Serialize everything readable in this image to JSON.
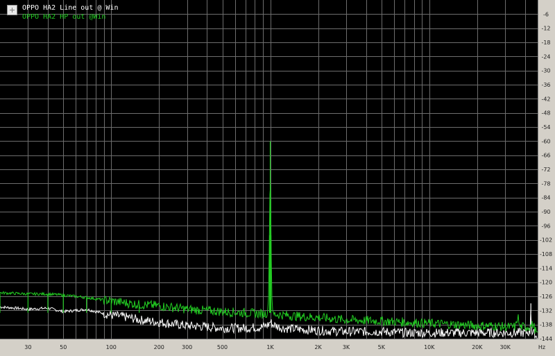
{
  "colors": {
    "plot_background": "#000000",
    "grid": "#6e6e6e",
    "window": "#d4d0c8",
    "series_white": "#ffffff",
    "series_green": "#22cc22"
  },
  "legend": {
    "icon": "legend-toggle-icon",
    "entries": [
      {
        "label": "OPPO HA2 Line out @ Win",
        "color": "#ffffff"
      },
      {
        "label": "OPPO HA2 HP out @Win",
        "color": "#22cc22"
      }
    ]
  },
  "chart_data": {
    "type": "line",
    "title": "",
    "xlabel": "",
    "ylabel": "",
    "x_scale": "log",
    "xlim": [
      20,
      48000
    ],
    "ylim": [
      0,
      -144
    ],
    "grid": true,
    "legend_position": "top-left",
    "x_ticks": [
      {
        "value": 30,
        "label": "30"
      },
      {
        "value": 50,
        "label": "50"
      },
      {
        "value": 100,
        "label": "100"
      },
      {
        "value": 200,
        "label": "200"
      },
      {
        "value": 300,
        "label": "300"
      },
      {
        "value": 500,
        "label": "500"
      },
      {
        "value": 1000,
        "label": "1K"
      },
      {
        "value": 2000,
        "label": "2K"
      },
      {
        "value": 3000,
        "label": "3K"
      },
      {
        "value": 5000,
        "label": "5K"
      },
      {
        "value": 10000,
        "label": "10K"
      },
      {
        "value": 20000,
        "label": "20K"
      },
      {
        "value": 30000,
        "label": "30K"
      }
    ],
    "x_unit_label": "Hz",
    "y_ticks": [
      {
        "value": -6,
        "label": "-6"
      },
      {
        "value": -12,
        "label": "-12"
      },
      {
        "value": -18,
        "label": "-18"
      },
      {
        "value": -24,
        "label": "-24"
      },
      {
        "value": -30,
        "label": "-30"
      },
      {
        "value": -36,
        "label": "-36"
      },
      {
        "value": -42,
        "label": "-42"
      },
      {
        "value": -48,
        "label": "-48"
      },
      {
        "value": -54,
        "label": "-54"
      },
      {
        "value": -60,
        "label": "-60"
      },
      {
        "value": -66,
        "label": "-66"
      },
      {
        "value": -72,
        "label": "-72"
      },
      {
        "value": -78,
        "label": "-78"
      },
      {
        "value": -84,
        "label": "-84"
      },
      {
        "value": -90,
        "label": "-90"
      },
      {
        "value": -96,
        "label": "-96"
      },
      {
        "value": -102,
        "label": "-102"
      },
      {
        "value": -108,
        "label": "-108"
      },
      {
        "value": -114,
        "label": "-114"
      },
      {
        "value": -120,
        "label": "-120"
      },
      {
        "value": -126,
        "label": "-126"
      },
      {
        "value": -132,
        "label": "-132"
      },
      {
        "value": -138,
        "label": "-138"
      },
      {
        "value": -144,
        "label": "-144"
      }
    ],
    "series": [
      {
        "name": "OPPO HA2 Line out @ Win",
        "color": "#ffffff",
        "points": [
          [
            20,
            -130.5
          ],
          [
            25,
            -131.0
          ],
          [
            30,
            -131.5
          ],
          [
            40,
            -131.0
          ],
          [
            50,
            -132.5
          ],
          [
            60,
            -132.0
          ],
          [
            70,
            -131.5
          ],
          [
            80,
            -132.5
          ],
          [
            100,
            -134.0
          ],
          [
            130,
            -135.0
          ],
          [
            150,
            -136.0
          ],
          [
            200,
            -137.0
          ],
          [
            300,
            -138.5
          ],
          [
            400,
            -139.0
          ],
          [
            500,
            -139.5
          ],
          [
            700,
            -139.5
          ],
          [
            900,
            -139.0
          ],
          [
            980,
            -138.0
          ],
          [
            1000,
            -136.5
          ],
          [
            1030,
            -138.0
          ],
          [
            1200,
            -139.5
          ],
          [
            1500,
            -140.0
          ],
          [
            2000,
            -140.5
          ],
          [
            3000,
            -141.0
          ],
          [
            5000,
            -141.0
          ],
          [
            7000,
            -141.5
          ],
          [
            10000,
            -141.5
          ],
          [
            15000,
            -141.5
          ],
          [
            20000,
            -141.5
          ],
          [
            30000,
            -141.5
          ],
          [
            40000,
            -141.5
          ],
          [
            43000,
            -141.0
          ],
          [
            43500,
            -129.0
          ],
          [
            44000,
            -141.5
          ],
          [
            46000,
            -142.0
          ],
          [
            48000,
            -144.0
          ]
        ]
      },
      {
        "name": "OPPO HA2 HP out @Win",
        "color": "#22cc22",
        "points": [
          [
            20,
            -124.5
          ],
          [
            30,
            -125.0
          ],
          [
            40,
            -125.0
          ],
          [
            50,
            -125.5
          ],
          [
            70,
            -126.5
          ],
          [
            100,
            -128.0
          ],
          [
            150,
            -129.5
          ],
          [
            200,
            -130.0
          ],
          [
            300,
            -131.5
          ],
          [
            500,
            -132.5
          ],
          [
            700,
            -133.0
          ],
          [
            900,
            -133.5
          ],
          [
            970,
            -133.0
          ],
          [
            990,
            -100.0
          ],
          [
            1000,
            -60.0
          ],
          [
            1010,
            -100.0
          ],
          [
            1030,
            -133.5
          ],
          [
            1500,
            -134.5
          ],
          [
            2000,
            -135.0
          ],
          [
            3000,
            -136.0
          ],
          [
            5000,
            -136.5
          ],
          [
            7000,
            -137.0
          ],
          [
            10000,
            -137.5
          ],
          [
            15000,
            -138.0
          ],
          [
            20000,
            -138.5
          ],
          [
            25000,
            -138.5
          ],
          [
            30000,
            -139.0
          ],
          [
            35000,
            -139.0
          ],
          [
            36000,
            -134.0
          ],
          [
            37000,
            -139.0
          ],
          [
            42000,
            -139.0
          ],
          [
            45000,
            -138.0
          ],
          [
            48000,
            -143.0
          ]
        ]
      }
    ]
  }
}
